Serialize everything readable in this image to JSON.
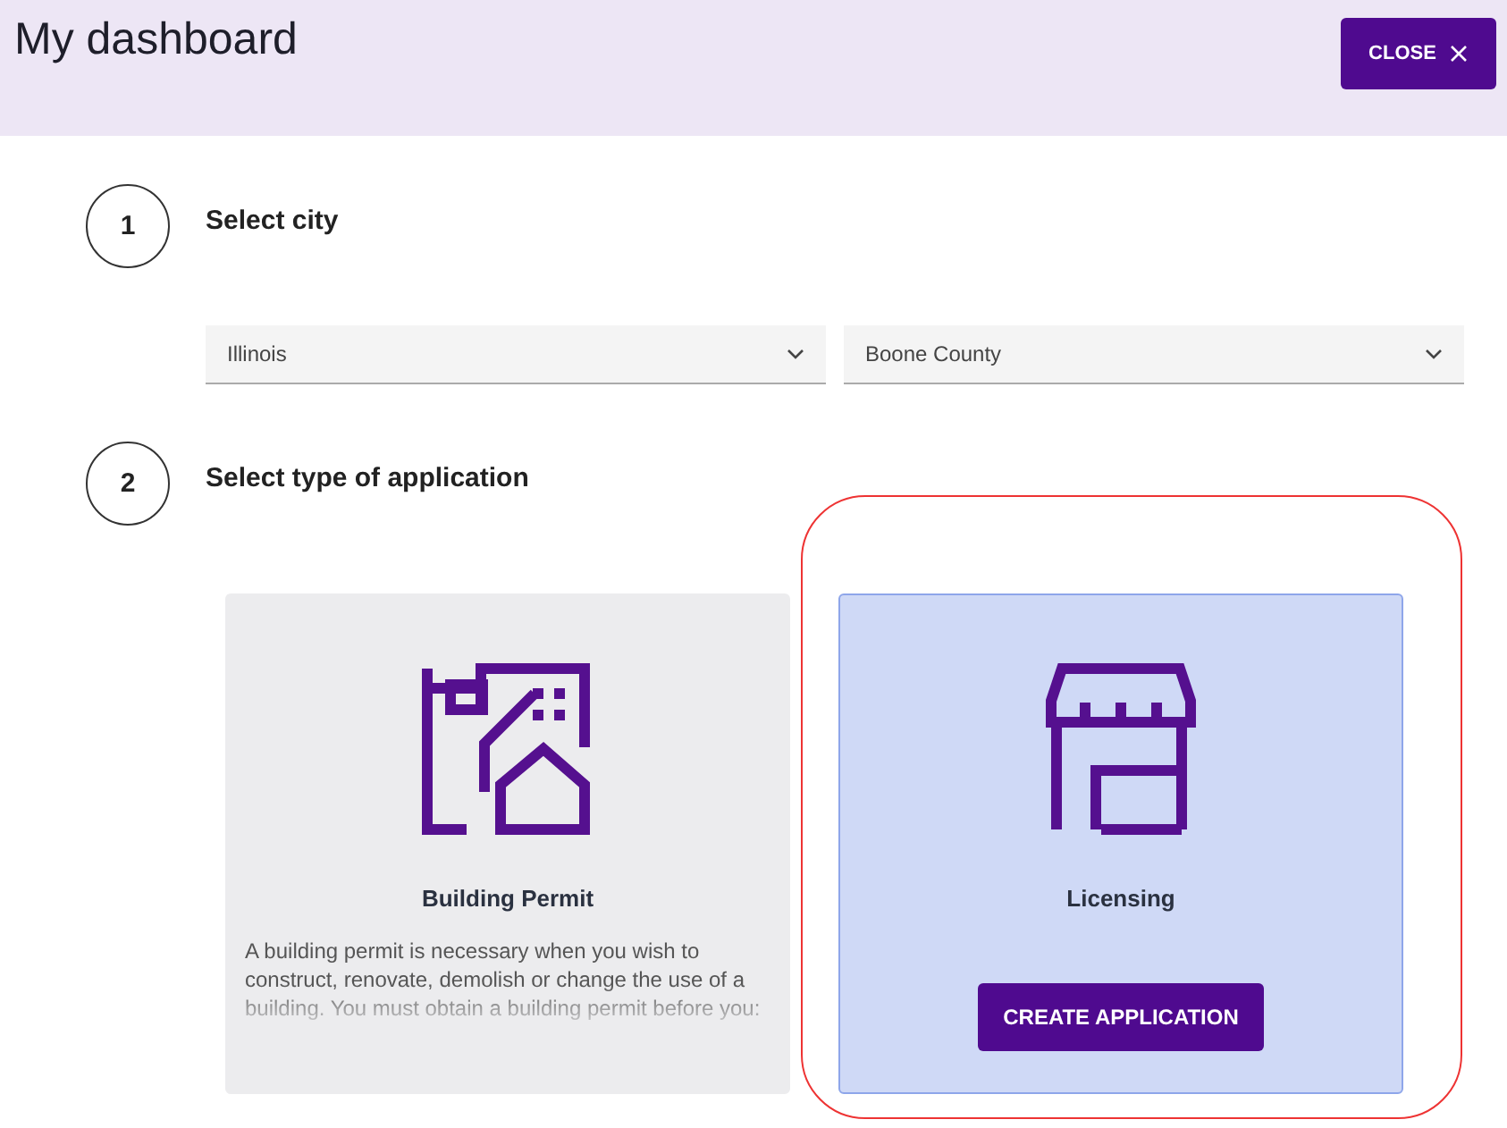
{
  "header": {
    "title": "My dashboard",
    "close_button": "CLOSE"
  },
  "steps": [
    {
      "number": "1",
      "title": "Select city"
    },
    {
      "number": "2",
      "title": "Select type of application"
    }
  ],
  "selects": [
    {
      "value": "Illinois"
    },
    {
      "value": "Boone County"
    }
  ],
  "cards": [
    {
      "kind": "building",
      "title": "Building Permit",
      "selected": false,
      "description": "A building permit is necessary when you wish to construct, renovate, demolish or change the use of a building. You must obtain a building permit before you:"
    },
    {
      "kind": "shop",
      "title": "Licensing",
      "selected": true,
      "button": "CREATE APPLICATION"
    }
  ]
}
